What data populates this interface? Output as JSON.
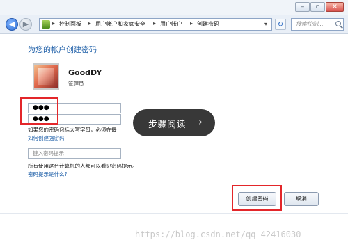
{
  "window": {
    "controls": {
      "minimize": "‒",
      "maximize": "▫",
      "close": "✕"
    }
  },
  "nav": {
    "back_glyph": "◀",
    "forward_glyph": "▶",
    "breadcrumbs": [
      "控制面板",
      "用户帐户和家庭安全",
      "用户帐户",
      "创建密码"
    ],
    "separator": "▸",
    "dropdown_glyph": "▾",
    "refresh_glyph": "↻",
    "search_placeholder": "搜索控制..."
  },
  "page": {
    "title": "为您的帐户创建密码",
    "user": {
      "name": "GoodDY",
      "role": "管理员"
    },
    "password_value": "●●●",
    "confirm_value": "●●●",
    "case_note": "如果您的密码包括大写字母，必须在每",
    "strong_password_link": "如何创建强密码",
    "hint_placeholder": "键入密码提示",
    "hint_note": "所有使用这台计算机的人都可以看见密码提示。",
    "hint_link": "密码提示是什么?"
  },
  "overlay": {
    "label": "步骤阅读",
    "chevron": "›"
  },
  "buttons": {
    "create": "创建密码",
    "cancel": "取消"
  },
  "watermark": "https://blog.csdn.net/qq_42416030",
  "colors": {
    "highlight": "#e3262a",
    "link": "#1e5fa8",
    "title": "#1e5fa8"
  }
}
